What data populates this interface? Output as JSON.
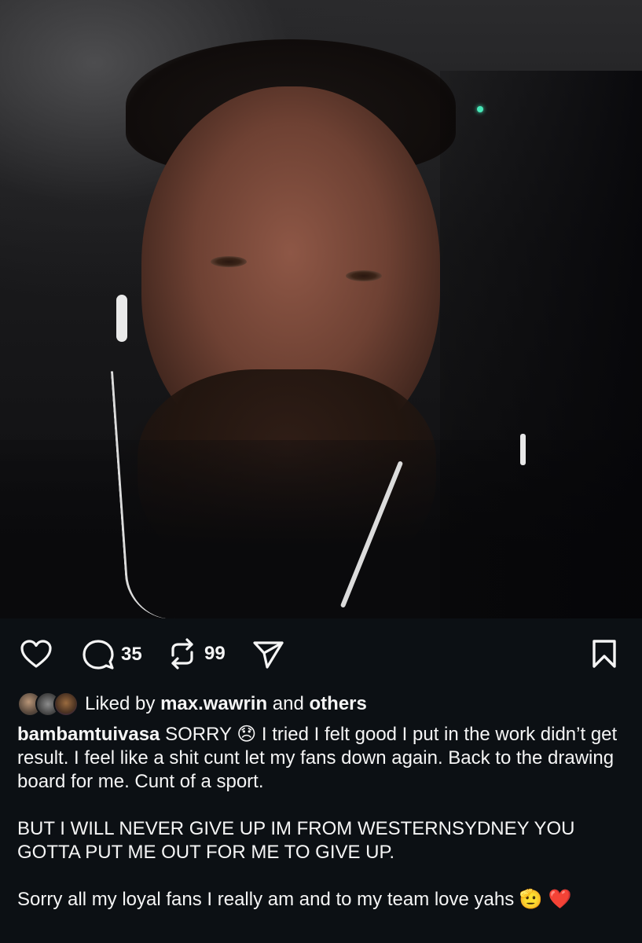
{
  "post": {
    "photo_alt": "selfie",
    "actions": {
      "comment_count": "35",
      "repost_count": "99"
    },
    "likes": {
      "prefix": "Liked by",
      "liker": "max.wawrin",
      "joiner": "and",
      "others": "others"
    },
    "caption": {
      "username": "bambamtuivasa",
      "paragraph1": "SORRY 😞 I tried I felt good I put in the work didn’t get result.  I feel like a shit cunt let my fans down again. Back to the drawing board for me. Cunt of a sport.",
      "paragraph2": "BUT I WILL NEVER GIVE UP IM FROM WESTERNSYDNEY YOU GOTTA PUT ME OUT FOR ME TO GIVE UP.",
      "paragraph3": "Sorry all my loyal fans I really am and to my team love yahs 🫡 ❤️"
    }
  },
  "icons": {
    "like": "heart-icon",
    "comment": "comment-bubble-icon",
    "repost": "repost-arrows-icon",
    "share": "paper-plane-icon",
    "save": "bookmark-icon"
  },
  "colors": {
    "background": "#0c1014",
    "text": "#f5f5f5"
  }
}
